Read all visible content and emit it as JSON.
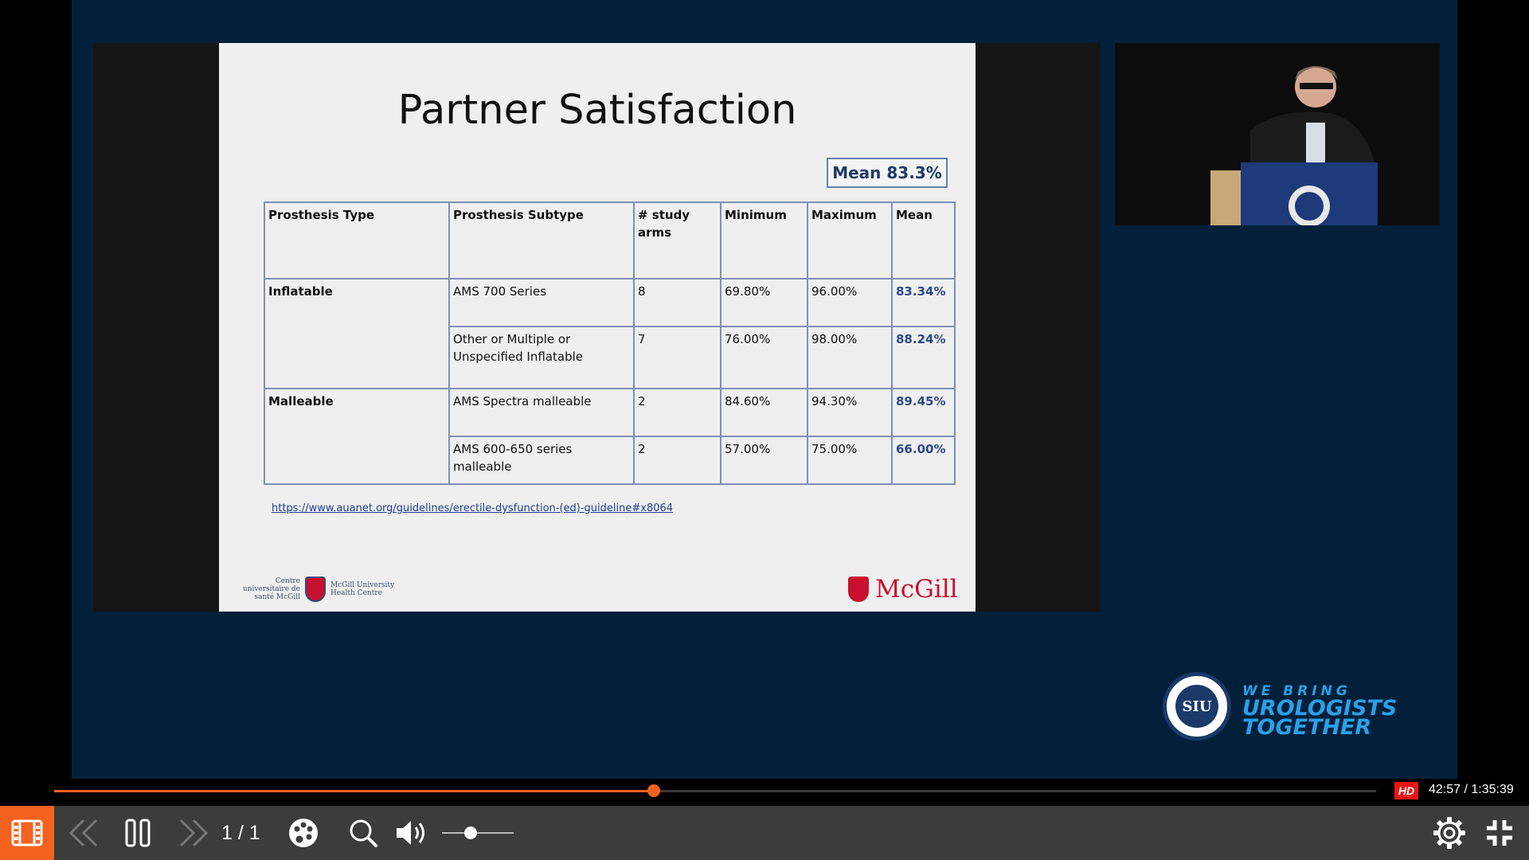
{
  "slide": {
    "title": "Partner Satisfaction",
    "mean_badge": "Mean 83.3%",
    "table": {
      "headers": [
        "Prosthesis Type",
        "Prosthesis Subtype",
        "# study arms",
        "Minimum",
        "Maximum",
        "Mean"
      ],
      "rows": [
        {
          "type": "Inflatable",
          "subtype": "AMS 700 Series",
          "arms": "8",
          "min": "69.80%",
          "max": "96.00%",
          "mean": "83.34%"
        },
        {
          "type": "",
          "subtype": "Other or Multiple or Unspecified Inflatable",
          "arms": "7",
          "min": "76.00%",
          "max": "98.00%",
          "mean": "88.24%"
        },
        {
          "type": "Malleable",
          "subtype": "AMS Spectra malleable",
          "arms": "2",
          "min": "84.60%",
          "max": "94.30%",
          "mean": "89.45%"
        },
        {
          "type": "",
          "subtype": "AMS 600-650 series malleable",
          "arms": "2",
          "min": "57.00%",
          "max": "75.00%",
          "mean": "66.00%"
        }
      ]
    },
    "reference_link": "https://www.auanet.org/guidelines/erectile-dysfunction-(ed)-guideline#x8064",
    "muhc_logo": {
      "left_text": "Centre universitaire de santé McGill",
      "right_text": "McGill University Health Centre"
    },
    "mcgill_logo": "McGill"
  },
  "branding": {
    "siu_logo_text": "SIU",
    "tagline": {
      "line1": "WE BRING",
      "line2": "UROLOGISTS",
      "line3": "TOGETHER"
    }
  },
  "player": {
    "progress_fraction": 0.4536,
    "quality_badge": "HD",
    "time": "42:57 / 1:35:39",
    "page_indicator": "1 / 1",
    "volume_fraction": 0.4,
    "colors": {
      "accent": "#f4621f",
      "background": "#03203a",
      "control_bar": "#3c3c3c"
    },
    "icons": [
      "slides-icon",
      "previous-icon",
      "pause-icon",
      "next-icon",
      "palette-icon",
      "search-icon",
      "volume-icon",
      "settings-icon",
      "exit-fullscreen-icon"
    ]
  }
}
